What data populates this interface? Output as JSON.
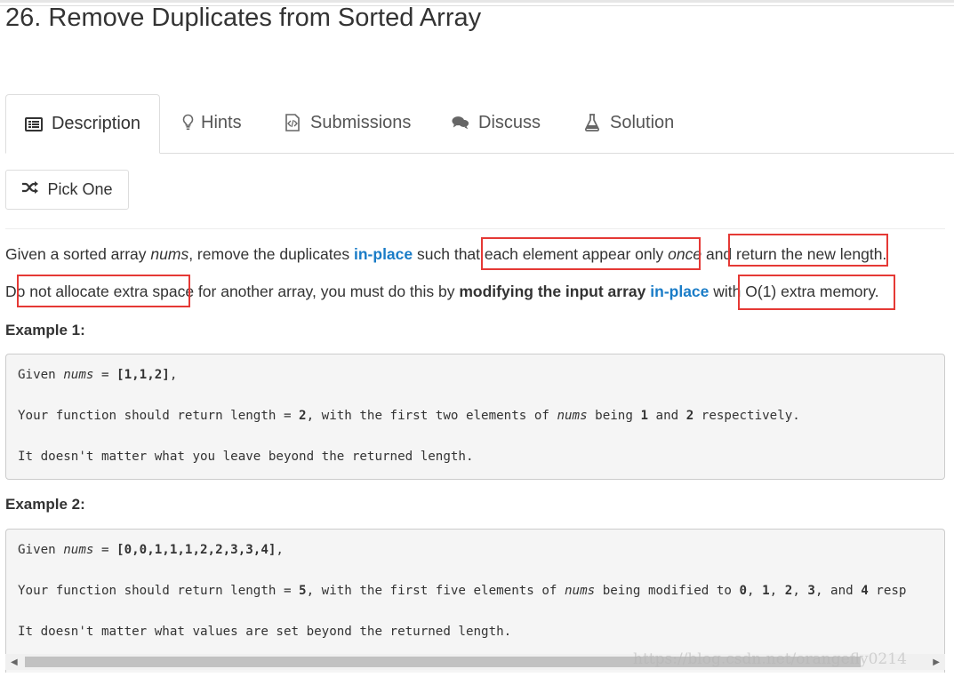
{
  "problem": {
    "title": "26. Remove Duplicates from Sorted Array"
  },
  "tabs": [
    {
      "label": "Description",
      "icon": "description-icon",
      "active": true
    },
    {
      "label": "Hints",
      "icon": "lightbulb-icon",
      "active": false
    },
    {
      "label": "Submissions",
      "icon": "code-file-icon",
      "active": false
    },
    {
      "label": "Discuss",
      "icon": "comments-icon",
      "active": false
    },
    {
      "label": "Solution",
      "icon": "flask-icon",
      "active": false
    }
  ],
  "pick_one": {
    "label": "Pick One",
    "icon": "shuffle-icon"
  },
  "description": {
    "p1": {
      "t1": "Given a sorted array ",
      "nums": "nums",
      "t2": ", remove the duplicates ",
      "inplace": "in-place",
      "t3": " such that each element appear only ",
      "once": "once",
      "t4": " and return the new length."
    },
    "p2": {
      "t1": "Do not allocate extra space for another array, you must do this by ",
      "bold": "modifying the input array",
      "t2": " ",
      "inplace": "in-place",
      "t3": " with O(1) extra memory."
    }
  },
  "examples": [
    {
      "label": "Example 1:",
      "l1a": "Given ",
      "l1nums": "nums",
      "l1b": " = ",
      "l1arr": "[1,1,2]",
      "l1c": ",",
      "l2a": "Your function should return length = ",
      "l2n": "2",
      "l2b": ", with the first two elements of ",
      "l2nums": "nums",
      "l2c": " being ",
      "l2v1": "1",
      "l2d": " and ",
      "l2v2": "2",
      "l2e": " respectively.",
      "l3": "It doesn't matter what you leave beyond the returned length."
    },
    {
      "label": "Example 2:",
      "l1a": "Given ",
      "l1nums": "nums",
      "l1b": " = ",
      "l1arr": "[0,0,1,1,1,2,2,3,3,4]",
      "l1c": ",",
      "l2a": "Your function should return length = ",
      "l2n": "5",
      "l2b": ", with the first five elements of ",
      "l2nums": "nums",
      "l2c": " being modified to ",
      "v0": "0",
      "c1": ", ",
      "v1": "1",
      "c2": ", ",
      "v2": "2",
      "c3": ", ",
      "v3": "3",
      "c4": ", and ",
      "v4": "4",
      "l2e": " resp",
      "l3": "It doesn't matter what values are set beyond the returned length."
    }
  ],
  "watermark": "https://blog.csdn.net/orangefly0214",
  "colors": {
    "link": "#1a7cc7",
    "highlight_box": "#e53935",
    "code_bg": "#f5f5f5"
  }
}
